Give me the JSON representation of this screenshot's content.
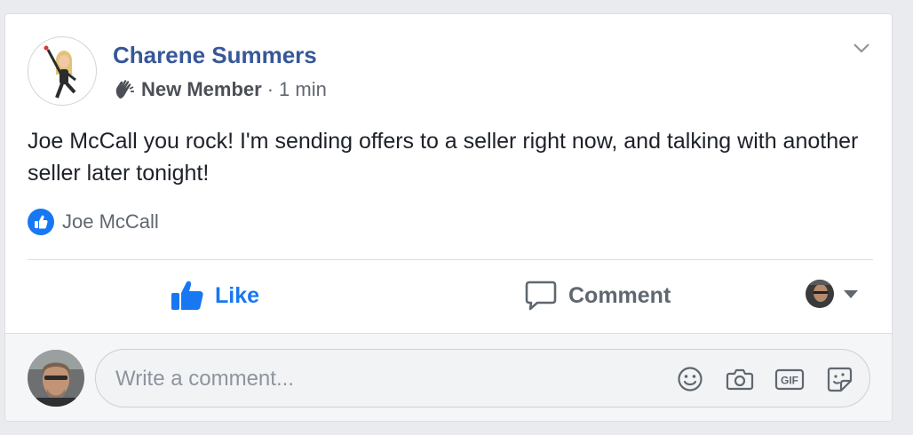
{
  "post": {
    "author": "Charene Summers",
    "badge": "New Member",
    "separator": "·",
    "time": "1 min",
    "text": "Joe McCall you rock! I'm sending offers to a seller right now, and talking with another seller later tonight!",
    "liked_by": "Joe McCall"
  },
  "actions": {
    "like_label": "Like",
    "comment_label": "Comment"
  },
  "comment_box": {
    "placeholder": "Write a comment...",
    "gif_label": "GIF"
  },
  "colors": {
    "link_blue": "#365899",
    "like_blue": "#1877f2",
    "text_gray": "#606770"
  },
  "icons": [
    "avatar-bitmoji",
    "wave-icon",
    "chevron-down-icon",
    "like-reaction-icon",
    "thumbs-up-icon",
    "comment-icon",
    "caret-down-icon",
    "emoji-icon",
    "camera-icon",
    "gif-icon",
    "sticker-icon"
  ]
}
